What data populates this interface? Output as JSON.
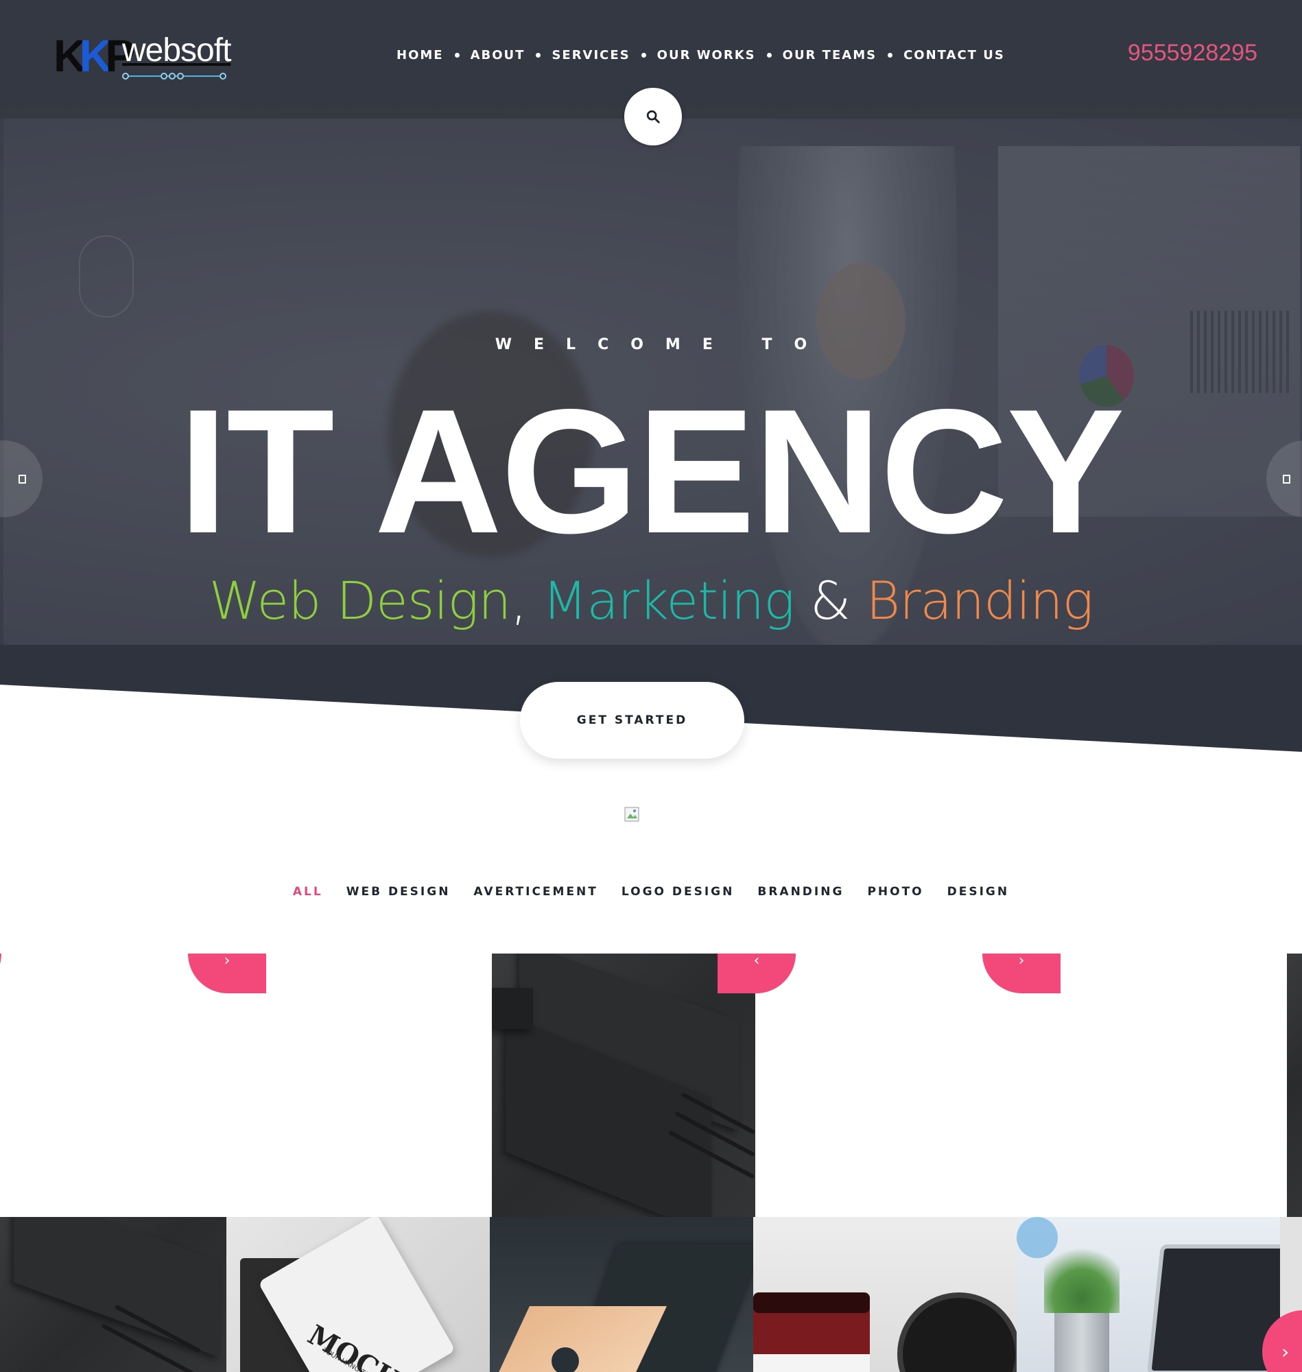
{
  "brand": {
    "logo_mark": "KKP",
    "logo_word": "websoft",
    "phone": "9555928295"
  },
  "nav": {
    "items": [
      "HOME",
      "ABOUT",
      "SERVICES",
      "OUR WORKS",
      "OUR TEAMS",
      "CONTACT US"
    ]
  },
  "hero": {
    "welcome": "WELCOME TO",
    "headline": "IT AGENCY",
    "sub_part1": "Web Design",
    "sub_comma": ",",
    "sub_part2": "Marketing",
    "sub_amp": "&",
    "sub_part3": "Branding",
    "cta_label": "GET STARTED"
  },
  "icons": {
    "search": "search-icon",
    "slide_prev": "square-icon",
    "slide_next": "square-icon",
    "tile_chevron": "chevron-icon",
    "next": "chevron-right-icon",
    "broken_image": "broken-image-icon"
  },
  "portfolio": {
    "filters": [
      "ALL",
      "WEB DESIGN",
      "AVERTICEMENT",
      "LOGO DESIGN",
      "BRANDING",
      "PHOTO",
      "DESIGN"
    ],
    "active_filter": "ALL",
    "mockup_tag_text": "MOCKUP",
    "mockup_tag_small": "YOUR HANG TAG"
  },
  "colors": {
    "accent_pink": "#f2497a",
    "phone_pink": "#e5567e",
    "header_dark": "#343842",
    "sub_green": "#8fcf3f",
    "sub_teal": "#1fb8a6",
    "sub_orange": "#f0894a"
  }
}
